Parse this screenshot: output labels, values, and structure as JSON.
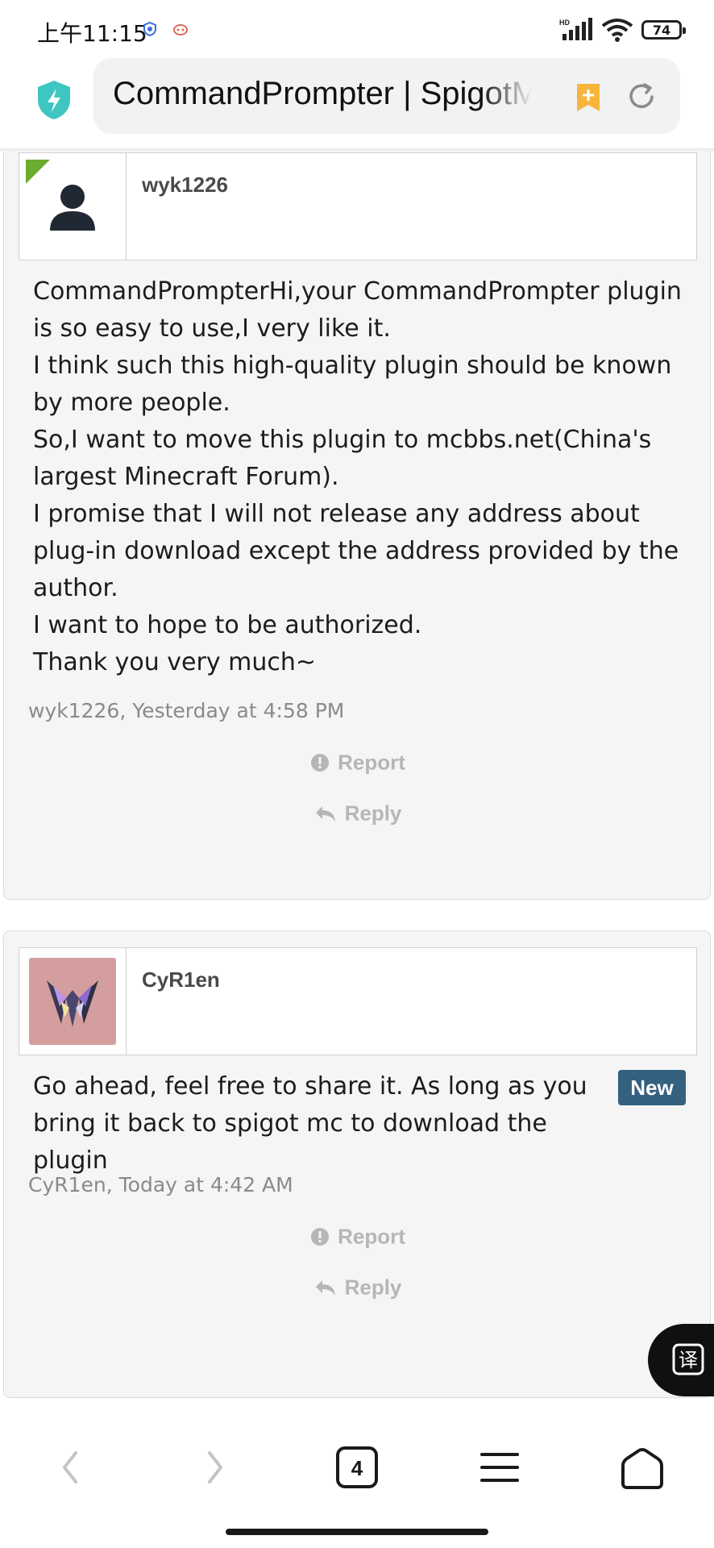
{
  "status_bar": {
    "time": "上午11:15",
    "network_label": "HD",
    "battery_level": "74"
  },
  "browser": {
    "url_title": "CommandPrompter | SpigotMC",
    "tab_count": "4"
  },
  "posts": [
    {
      "username": "wyk1226",
      "has_default_avatar": true,
      "message_lines": [
        "CommandPrompterHi,your CommandPrompter plugin is so easy to use,I very like it.",
        "I think such this high-quality plugin should be known by more people.",
        "So,I want to move this plugin to mcbbs.net(China's largest Minecraft Forum).",
        "I promise that I will not release any address about plug-in download except the address provided by the author.",
        "I want to hope to be authorized.",
        "Thank you very much~"
      ],
      "meta": "wyk1226, Yesterday at 4:58 PM",
      "report_label": "Report",
      "reply_label": "Reply"
    },
    {
      "username": "CyR1en",
      "has_default_avatar": false,
      "message_lines": [
        "Go ahead, feel free to share it. As long as you bring it back to spigot mc to download the plugin"
      ],
      "badge": "New",
      "meta": "CyR1en, Today at 4:42 AM",
      "report_label": "Report",
      "reply_label": "Reply"
    }
  ],
  "icons": {
    "shield": "shield-bolt-icon",
    "bookmark": "bookmark-add-icon",
    "reload": "reload-icon",
    "translate": "translate-icon",
    "back": "back-arrow-icon",
    "forward": "forward-arrow-icon",
    "menu": "menu-icon",
    "home": "home-icon"
  },
  "colors": {
    "shield": "#3ec6c0",
    "bookmark": "#f7b53c",
    "badge": "#34617f",
    "new_post_flag": "#6cac2e"
  }
}
